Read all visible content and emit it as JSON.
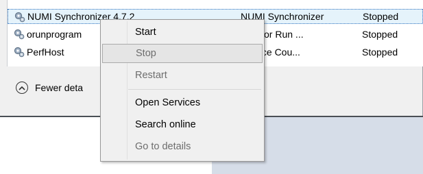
{
  "services": [
    {
      "name": "NUMI Synchronizer 4.7.2",
      "description": "NUMI Synchronizer",
      "status": "Stopped",
      "selected": true
    },
    {
      "name": "orunprogram",
      "description": "estrator Run ...",
      "status": "Stopped"
    },
    {
      "name": "PerfHost",
      "description": "rmance Cou...",
      "status": "Stopped"
    }
  ],
  "footer": {
    "fewer_details": "Fewer deta"
  },
  "context_menu": {
    "items": [
      {
        "label": "Start",
        "enabled": true
      },
      {
        "label": "Stop",
        "enabled": false,
        "highlighted": true
      },
      {
        "label": "Restart",
        "enabled": false
      },
      {
        "label": "Open Services",
        "enabled": true
      },
      {
        "label": "Search online",
        "enabled": true
      },
      {
        "label": "Go to details",
        "enabled": false
      }
    ]
  },
  "colors": {
    "selection": "#e5f3fb",
    "selection_border": "#2a6ebd",
    "panel": "#d6dde8"
  },
  "icons": {
    "service": "gear-icon",
    "collapse": "chevron-up-icon"
  }
}
